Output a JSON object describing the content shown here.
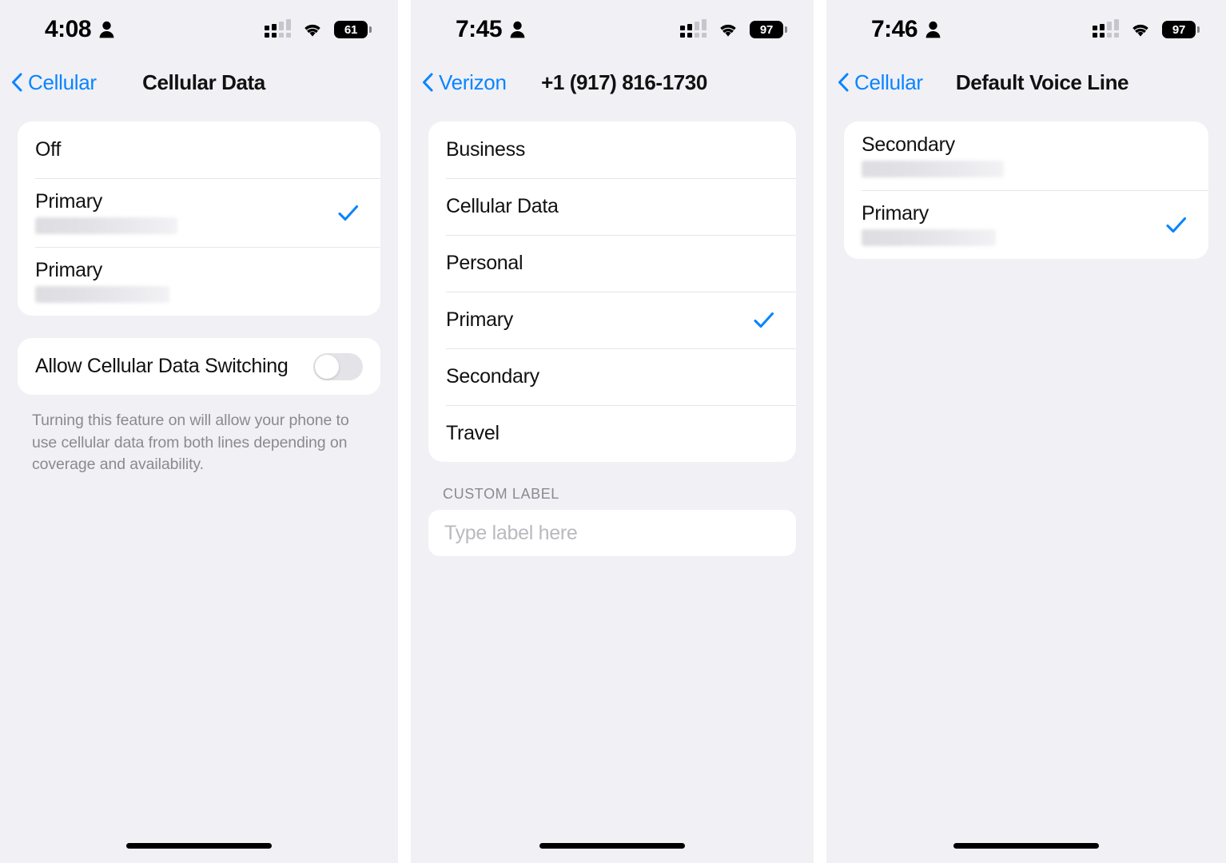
{
  "panels": [
    {
      "id": "cellular-data",
      "status_bar": {
        "time": "4:08",
        "person_icon": "person-icon",
        "cellular_icon": "cellular-signal-icon",
        "wifi_icon": "wifi-icon",
        "battery_level": "61"
      },
      "nav": {
        "back_label": "Cellular",
        "title": "Cellular Data"
      },
      "rows": [
        {
          "label": "Off",
          "redacted": false,
          "checked": false
        },
        {
          "label": "Primary",
          "redacted": true,
          "checked": true
        },
        {
          "label": "Primary",
          "redacted": true,
          "checked": false
        }
      ],
      "toggle": {
        "label": "Allow Cellular Data Switching",
        "on": false
      },
      "footnote": "Turning this feature on will allow your phone to use cellular data from both lines depending on coverage and availability."
    },
    {
      "id": "line-label",
      "status_bar": {
        "time": "7:45",
        "person_icon": "person-icon",
        "cellular_icon": "cellular-signal-icon",
        "wifi_icon": "wifi-icon",
        "battery_level": "97"
      },
      "nav": {
        "back_label": "Verizon",
        "title": "+1 (917) 816-1730"
      },
      "rows": [
        {
          "label": "Business",
          "redacted": false,
          "checked": false
        },
        {
          "label": "Cellular Data",
          "redacted": false,
          "checked": false
        },
        {
          "label": "Personal",
          "redacted": false,
          "checked": false
        },
        {
          "label": "Primary",
          "redacted": false,
          "checked": true
        },
        {
          "label": "Secondary",
          "redacted": false,
          "checked": false
        },
        {
          "label": "Travel",
          "redacted": false,
          "checked": false
        }
      ],
      "custom_label": {
        "header": "CUSTOM LABEL",
        "value": "",
        "placeholder": "Type label here"
      }
    },
    {
      "id": "default-voice-line",
      "status_bar": {
        "time": "7:46",
        "person_icon": "person-icon",
        "cellular_icon": "cellular-signal-icon",
        "wifi_icon": "wifi-icon",
        "battery_level": "97"
      },
      "nav": {
        "back_label": "Cellular",
        "title": "Default Voice Line"
      },
      "rows": [
        {
          "label": "Secondary",
          "redacted": true,
          "checked": false
        },
        {
          "label": "Primary",
          "redacted": true,
          "checked": true
        }
      ]
    }
  ],
  "colors": {
    "accent": "#0a84ff",
    "background": "#f0f0f5",
    "card": "#ffffff",
    "separator": "#e6e6ea",
    "secondary_text": "#8a8a8f"
  }
}
